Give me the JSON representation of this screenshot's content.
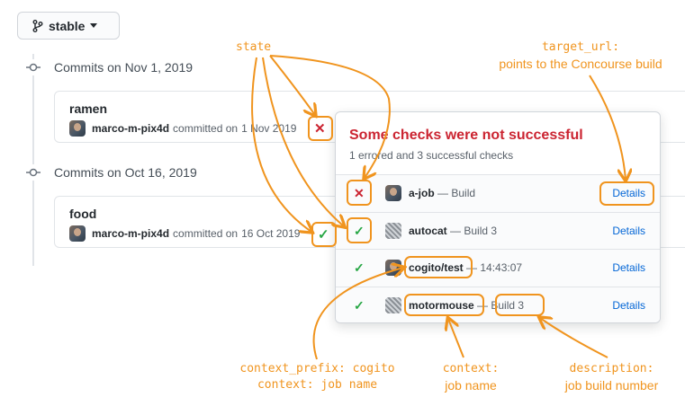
{
  "branch": {
    "label": "stable"
  },
  "commit_groups": [
    {
      "header": "Commits on Nov 1, 2019",
      "commit": {
        "title": "ramen",
        "author": "marco-m-pix4d",
        "committed": "committed on",
        "date": "1 Nov 2019",
        "status": "failure"
      }
    },
    {
      "header": "Commits on Oct 16, 2019",
      "commit": {
        "title": "food",
        "author": "marco-m-pix4d",
        "committed": "committed on",
        "date": "16 Oct 2019",
        "status": "success"
      }
    }
  ],
  "checks": {
    "title": "Some checks were not successful",
    "summary": "1 errored and 3 successful checks",
    "rows": [
      {
        "status": "error",
        "context": "a-job",
        "description": "— Build",
        "details": "Details"
      },
      {
        "status": "success",
        "context": "autocat",
        "description": "— Build 3",
        "details": "Details"
      },
      {
        "status": "success",
        "context": "cogito/test",
        "description": "— 14:43:07",
        "details": "Details"
      },
      {
        "status": "success",
        "context": "motormouse",
        "description": "— Build 3",
        "details": "Details"
      }
    ]
  },
  "annotations": {
    "state": "state",
    "target_url_1": "target_url:",
    "target_url_2": "points to the Concourse build",
    "context_prefix_1": "context_prefix: cogito",
    "context_prefix_2": "context: job name",
    "context_1": "context:",
    "context_2": "job name",
    "description_1": "description:",
    "description_2": "job build number"
  },
  "colors": {
    "annotation": "#f0941e",
    "error": "#cb2431",
    "success": "#28a745",
    "link": "#0366d6"
  }
}
